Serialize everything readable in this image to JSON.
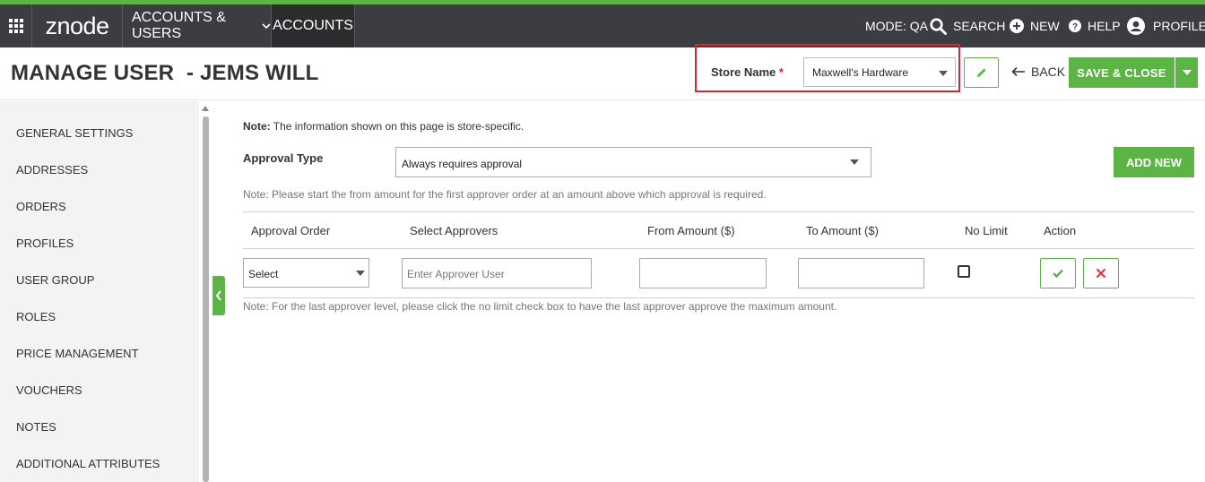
{
  "topbar": {
    "logo": "znode",
    "menu_accounts_users": "ACCOUNTS & USERS",
    "menu_accounts": "ACCOUNTS",
    "mode": "MODE: QA",
    "search": "SEARCH",
    "new": "NEW",
    "help": "HELP",
    "profile": "PROFILE"
  },
  "header": {
    "title": "MANAGE USER  - JEMS WILL",
    "store_label": "Store Name",
    "required_mark": "*",
    "store_value": "Maxwell's Hardware",
    "back": "BACK",
    "save_close": "SAVE & CLOSE"
  },
  "sidebar": {
    "items": [
      {
        "label": "GENERAL SETTINGS"
      },
      {
        "label": "ADDRESSES"
      },
      {
        "label": "ORDERS"
      },
      {
        "label": "PROFILES"
      },
      {
        "label": "USER GROUP"
      },
      {
        "label": "ROLES"
      },
      {
        "label": "PRICE MANAGEMENT"
      },
      {
        "label": "VOUCHERS"
      },
      {
        "label": "NOTES"
      },
      {
        "label": "ADDITIONAL ATTRIBUTES"
      }
    ]
  },
  "main": {
    "note_prefix": "Note:",
    "note_text": " The information shown on this page is store-specific.",
    "approval_type_label": "Approval Type",
    "approval_type_value": "Always requires approval",
    "add_new": "ADD NEW",
    "note_mid": "Note: Please start the from amount for the first approver order at an amount above which approval is required.",
    "table": {
      "headers": [
        "Approval Order",
        "Select Approvers",
        "From Amount ($)",
        "To Amount ($)",
        "No Limit",
        "Action"
      ],
      "order_select": "Select",
      "approver_placeholder": "Enter Approver User"
    },
    "note_bottom": "Note: For the last approver level, please click the no limit check box to have the last approver approve the maximum amount."
  },
  "colors": {
    "accent": "#5db446",
    "topbar": "#3b3d40",
    "highlight": "#d9262e"
  }
}
